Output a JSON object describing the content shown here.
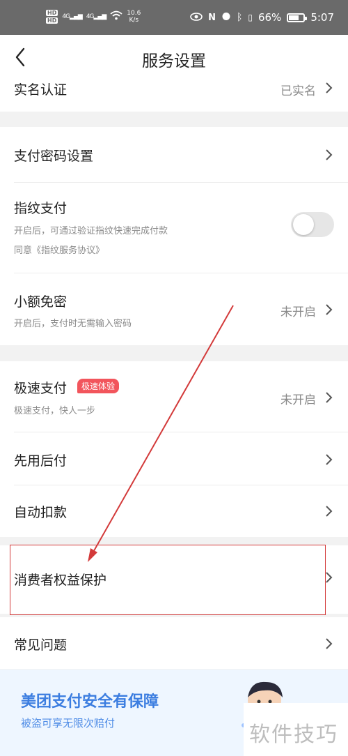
{
  "status_bar": {
    "hd1": "HD",
    "hd2": "HD",
    "signal1": "4G",
    "signal2": "4G",
    "speed_value": "10.6",
    "speed_unit": "K/s",
    "battery_percent": "66%",
    "time": "5:07"
  },
  "nav": {
    "title": "服务设置"
  },
  "rows": {
    "real_name": {
      "label": "实名认证",
      "value": "已实名"
    },
    "pay_password": {
      "label": "支付密码设置"
    },
    "fingerprint": {
      "label": "指纹支付",
      "sub1": "开启后，可通过验证指纹快速完成付款",
      "sub2": "同意《指纹服务协议》",
      "enabled": false
    },
    "small_free": {
      "label": "小额免密",
      "sub": "开启后，支付时无需输入密码",
      "value": "未开启"
    },
    "fast_pay": {
      "label": "极速支付",
      "badge": "极速体验",
      "sub": "极速支付，快人一步",
      "value": "未开启"
    },
    "pay_later": {
      "label": "先用后付"
    },
    "auto_debit": {
      "label": "自动扣款"
    },
    "consumer_rights": {
      "label": "消费者权益保护"
    },
    "faq": {
      "label": "常见问题"
    }
  },
  "banner": {
    "title": "美团支付安全有保障",
    "subtitle": "被盗可享无限次赔付"
  },
  "watermark": {
    "text": "软件技巧"
  },
  "colors": {
    "accent_blue": "#3b7de0",
    "badge_red": "#f2555c",
    "annotation_red": "#d33a3a"
  }
}
